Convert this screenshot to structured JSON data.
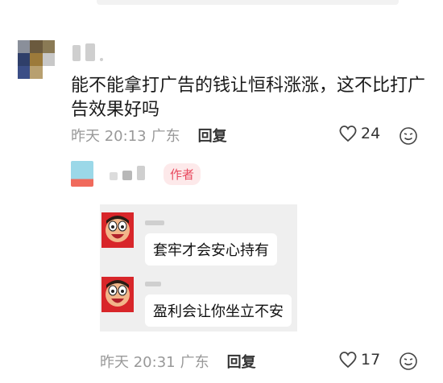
{
  "comment": {
    "content": "能不能拿打广告的钱让恒科涨涨，这不比打广告效果好吗",
    "time": "昨天 20:13",
    "location": "广东",
    "reply_label": "回复",
    "like_count": "24"
  },
  "reply": {
    "author_badge": "作者",
    "meme_lines": [
      "套牢才会安心持有",
      "盈利会让你坐立不安"
    ],
    "time": "昨天 20:31",
    "location": "广东",
    "reply_label": "回复",
    "like_count": "17"
  },
  "colors": {
    "badge_text": "#e84a5f",
    "badge_bg": "#fde9ea",
    "meta": "#999999"
  }
}
